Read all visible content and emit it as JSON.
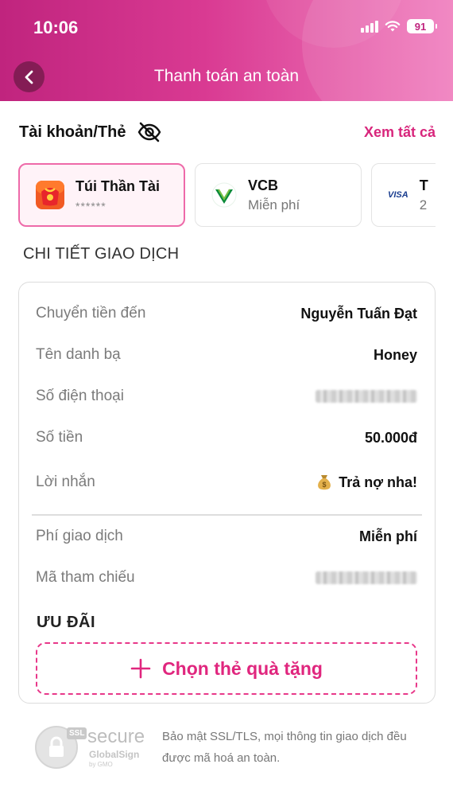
{
  "status_bar": {
    "time": "10:06",
    "battery": "91"
  },
  "header": {
    "title": "Thanh toán an toàn"
  },
  "accounts": {
    "title": "Tài khoản/Thẻ",
    "see_all": "Xem tất cả",
    "cards": [
      {
        "name": "Túi Thần Tài",
        "sub": "******",
        "selected": true
      },
      {
        "name": "VCB",
        "sub": "Miễn phí",
        "selected": false
      },
      {
        "name": "T",
        "sub": "2",
        "selected": false
      }
    ],
    "visa_text": "VISA"
  },
  "details": {
    "title": "CHI TIẾT GIAO DỊCH",
    "rows": [
      {
        "label": "Chuyển tiền đến",
        "value": "Nguyễn Tuấn Đạt"
      },
      {
        "label": "Tên danh bạ",
        "value": "Honey"
      },
      {
        "label": "Số điện thoại",
        "value": ""
      },
      {
        "label": "Số tiền",
        "value": "50.000đ"
      },
      {
        "label": "Lời nhắn",
        "value": "Trả nợ nha!"
      }
    ],
    "fee_rows": [
      {
        "label": "Phí giao dịch",
        "value": "Miễn phí"
      },
      {
        "label": "Mã tham chiếu",
        "value": ""
      }
    ],
    "offers_title": "ƯU ĐÃI",
    "gift_button": "Chọn thẻ quà tặng"
  },
  "footer": {
    "badge_ssl": "SSL",
    "badge_secure": "secure",
    "badge_globalsign": "GlobalSign",
    "badge_gmo": "by GMO",
    "text": "Bảo mật SSL/TLS, mọi thông tin giao dịch đều được mã hoá an toàn."
  },
  "colors": {
    "brand": "#d8267c",
    "header_start": "#c0247e",
    "header_end": "#f07cbd"
  }
}
